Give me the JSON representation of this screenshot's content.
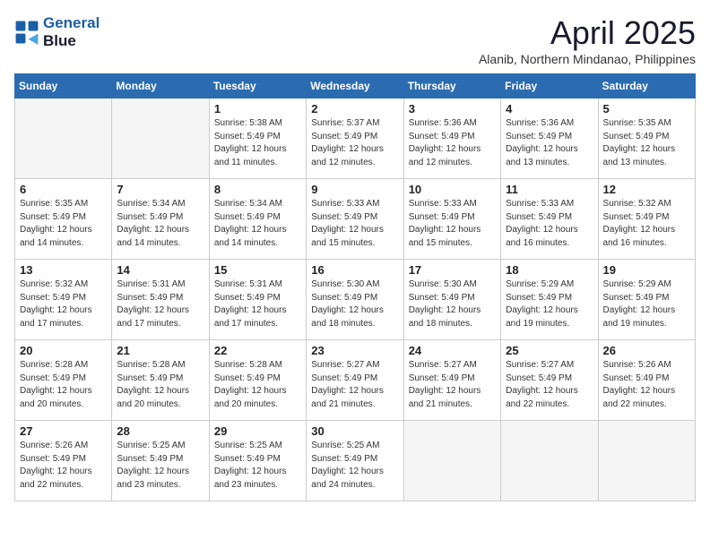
{
  "header": {
    "logo_line1": "General",
    "logo_line2": "Blue",
    "month_title": "April 2025",
    "location": "Alanib, Northern Mindanao, Philippines"
  },
  "columns": [
    "Sunday",
    "Monday",
    "Tuesday",
    "Wednesday",
    "Thursday",
    "Friday",
    "Saturday"
  ],
  "weeks": [
    [
      {
        "day": "",
        "detail": ""
      },
      {
        "day": "",
        "detail": ""
      },
      {
        "day": "1",
        "detail": "Sunrise: 5:38 AM\nSunset: 5:49 PM\nDaylight: 12 hours\nand 11 minutes."
      },
      {
        "day": "2",
        "detail": "Sunrise: 5:37 AM\nSunset: 5:49 PM\nDaylight: 12 hours\nand 12 minutes."
      },
      {
        "day": "3",
        "detail": "Sunrise: 5:36 AM\nSunset: 5:49 PM\nDaylight: 12 hours\nand 12 minutes."
      },
      {
        "day": "4",
        "detail": "Sunrise: 5:36 AM\nSunset: 5:49 PM\nDaylight: 12 hours\nand 13 minutes."
      },
      {
        "day": "5",
        "detail": "Sunrise: 5:35 AM\nSunset: 5:49 PM\nDaylight: 12 hours\nand 13 minutes."
      }
    ],
    [
      {
        "day": "6",
        "detail": "Sunrise: 5:35 AM\nSunset: 5:49 PM\nDaylight: 12 hours\nand 14 minutes."
      },
      {
        "day": "7",
        "detail": "Sunrise: 5:34 AM\nSunset: 5:49 PM\nDaylight: 12 hours\nand 14 minutes."
      },
      {
        "day": "8",
        "detail": "Sunrise: 5:34 AM\nSunset: 5:49 PM\nDaylight: 12 hours\nand 14 minutes."
      },
      {
        "day": "9",
        "detail": "Sunrise: 5:33 AM\nSunset: 5:49 PM\nDaylight: 12 hours\nand 15 minutes."
      },
      {
        "day": "10",
        "detail": "Sunrise: 5:33 AM\nSunset: 5:49 PM\nDaylight: 12 hours\nand 15 minutes."
      },
      {
        "day": "11",
        "detail": "Sunrise: 5:33 AM\nSunset: 5:49 PM\nDaylight: 12 hours\nand 16 minutes."
      },
      {
        "day": "12",
        "detail": "Sunrise: 5:32 AM\nSunset: 5:49 PM\nDaylight: 12 hours\nand 16 minutes."
      }
    ],
    [
      {
        "day": "13",
        "detail": "Sunrise: 5:32 AM\nSunset: 5:49 PM\nDaylight: 12 hours\nand 17 minutes."
      },
      {
        "day": "14",
        "detail": "Sunrise: 5:31 AM\nSunset: 5:49 PM\nDaylight: 12 hours\nand 17 minutes."
      },
      {
        "day": "15",
        "detail": "Sunrise: 5:31 AM\nSunset: 5:49 PM\nDaylight: 12 hours\nand 17 minutes."
      },
      {
        "day": "16",
        "detail": "Sunrise: 5:30 AM\nSunset: 5:49 PM\nDaylight: 12 hours\nand 18 minutes."
      },
      {
        "day": "17",
        "detail": "Sunrise: 5:30 AM\nSunset: 5:49 PM\nDaylight: 12 hours\nand 18 minutes."
      },
      {
        "day": "18",
        "detail": "Sunrise: 5:29 AM\nSunset: 5:49 PM\nDaylight: 12 hours\nand 19 minutes."
      },
      {
        "day": "19",
        "detail": "Sunrise: 5:29 AM\nSunset: 5:49 PM\nDaylight: 12 hours\nand 19 minutes."
      }
    ],
    [
      {
        "day": "20",
        "detail": "Sunrise: 5:28 AM\nSunset: 5:49 PM\nDaylight: 12 hours\nand 20 minutes."
      },
      {
        "day": "21",
        "detail": "Sunrise: 5:28 AM\nSunset: 5:49 PM\nDaylight: 12 hours\nand 20 minutes."
      },
      {
        "day": "22",
        "detail": "Sunrise: 5:28 AM\nSunset: 5:49 PM\nDaylight: 12 hours\nand 20 minutes."
      },
      {
        "day": "23",
        "detail": "Sunrise: 5:27 AM\nSunset: 5:49 PM\nDaylight: 12 hours\nand 21 minutes."
      },
      {
        "day": "24",
        "detail": "Sunrise: 5:27 AM\nSunset: 5:49 PM\nDaylight: 12 hours\nand 21 minutes."
      },
      {
        "day": "25",
        "detail": "Sunrise: 5:27 AM\nSunset: 5:49 PM\nDaylight: 12 hours\nand 22 minutes."
      },
      {
        "day": "26",
        "detail": "Sunrise: 5:26 AM\nSunset: 5:49 PM\nDaylight: 12 hours\nand 22 minutes."
      }
    ],
    [
      {
        "day": "27",
        "detail": "Sunrise: 5:26 AM\nSunset: 5:49 PM\nDaylight: 12 hours\nand 22 minutes."
      },
      {
        "day": "28",
        "detail": "Sunrise: 5:25 AM\nSunset: 5:49 PM\nDaylight: 12 hours\nand 23 minutes."
      },
      {
        "day": "29",
        "detail": "Sunrise: 5:25 AM\nSunset: 5:49 PM\nDaylight: 12 hours\nand 23 minutes."
      },
      {
        "day": "30",
        "detail": "Sunrise: 5:25 AM\nSunset: 5:49 PM\nDaylight: 12 hours\nand 24 minutes."
      },
      {
        "day": "",
        "detail": ""
      },
      {
        "day": "",
        "detail": ""
      },
      {
        "day": "",
        "detail": ""
      }
    ]
  ]
}
